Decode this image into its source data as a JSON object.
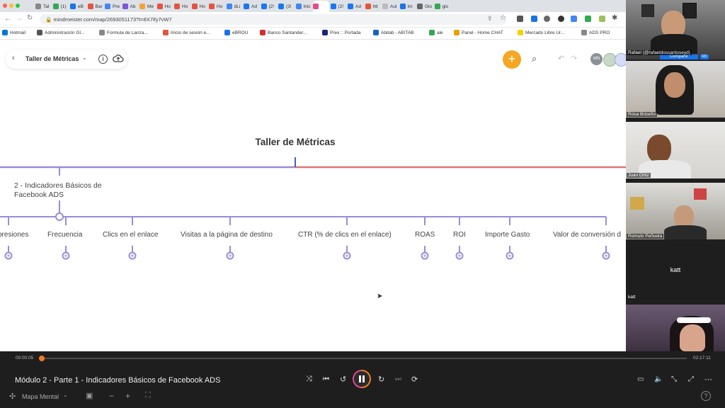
{
  "browser": {
    "tabs": [
      "Tal",
      "(1)",
      "eB",
      "Bar",
      "Pre",
      "Ab",
      "Me",
      "Ho",
      "Ho",
      "Ho",
      "Ho",
      "dLi",
      "Ad",
      "(2!",
      "(3!",
      "Inic",
      "",
      "(2!",
      "Ad",
      "htt",
      "Aul",
      "Im",
      "Glo",
      "glo"
    ],
    "url": "mindmeister.com/map/2693051173?t=8X7ify7vW7",
    "bookmarks": [
      "Hotmail",
      "Administración Gl...",
      "Formula de Lanza...",
      "Inicio de sesión e...",
      "eBROU",
      "Banco Santander...",
      "Prex :: Portada",
      "Abitab - ABITAB",
      "ale",
      "Panel - Home CHAT",
      "Mercado Libre Ur...",
      "ADS PRO"
    ]
  },
  "mindmap": {
    "map_title": "Taller de Métricas",
    "root_topic": "Taller de Métricas",
    "branch_topic_line1": "2 - Indicadores Básicos de",
    "branch_topic_line2": "Facebook ADS",
    "subtopics": [
      "presiones",
      "Frecuencia",
      "Clics en el enlace",
      "Visitas a la página de destino",
      "CTR (% de clics en el enlace)",
      "ROAS",
      "ROI",
      "Importe Gasto",
      "Valor de conversión d"
    ],
    "avatar_initials": "MN",
    "colors": {
      "purple": "#9b8bd9",
      "red": "#e0747a",
      "node_fill": "#b9a9ee",
      "add_button": "#f5a623"
    }
  },
  "player": {
    "time_current": "00:00:05",
    "time_total": "02:17:11",
    "progress_fraction": 0.0006,
    "video_title": "Módulo 2 - Parte 1 - Indicadores Básicos de Facebook ADS",
    "mode_label": "Mapa Mental"
  },
  "participants": [
    {
      "name": "Rafael (@rafaeldossantoseyd)"
    },
    {
      "name": "Rosa Briceño"
    },
    {
      "name": "Juan Ortiz"
    },
    {
      "name": "Romulo Peñuela"
    },
    {
      "name": "katt",
      "center_label": "katt"
    },
    {
      "name": ""
    }
  ],
  "speaker_overlay": {
    "share_label": "Compartir",
    "badge": "RD"
  }
}
